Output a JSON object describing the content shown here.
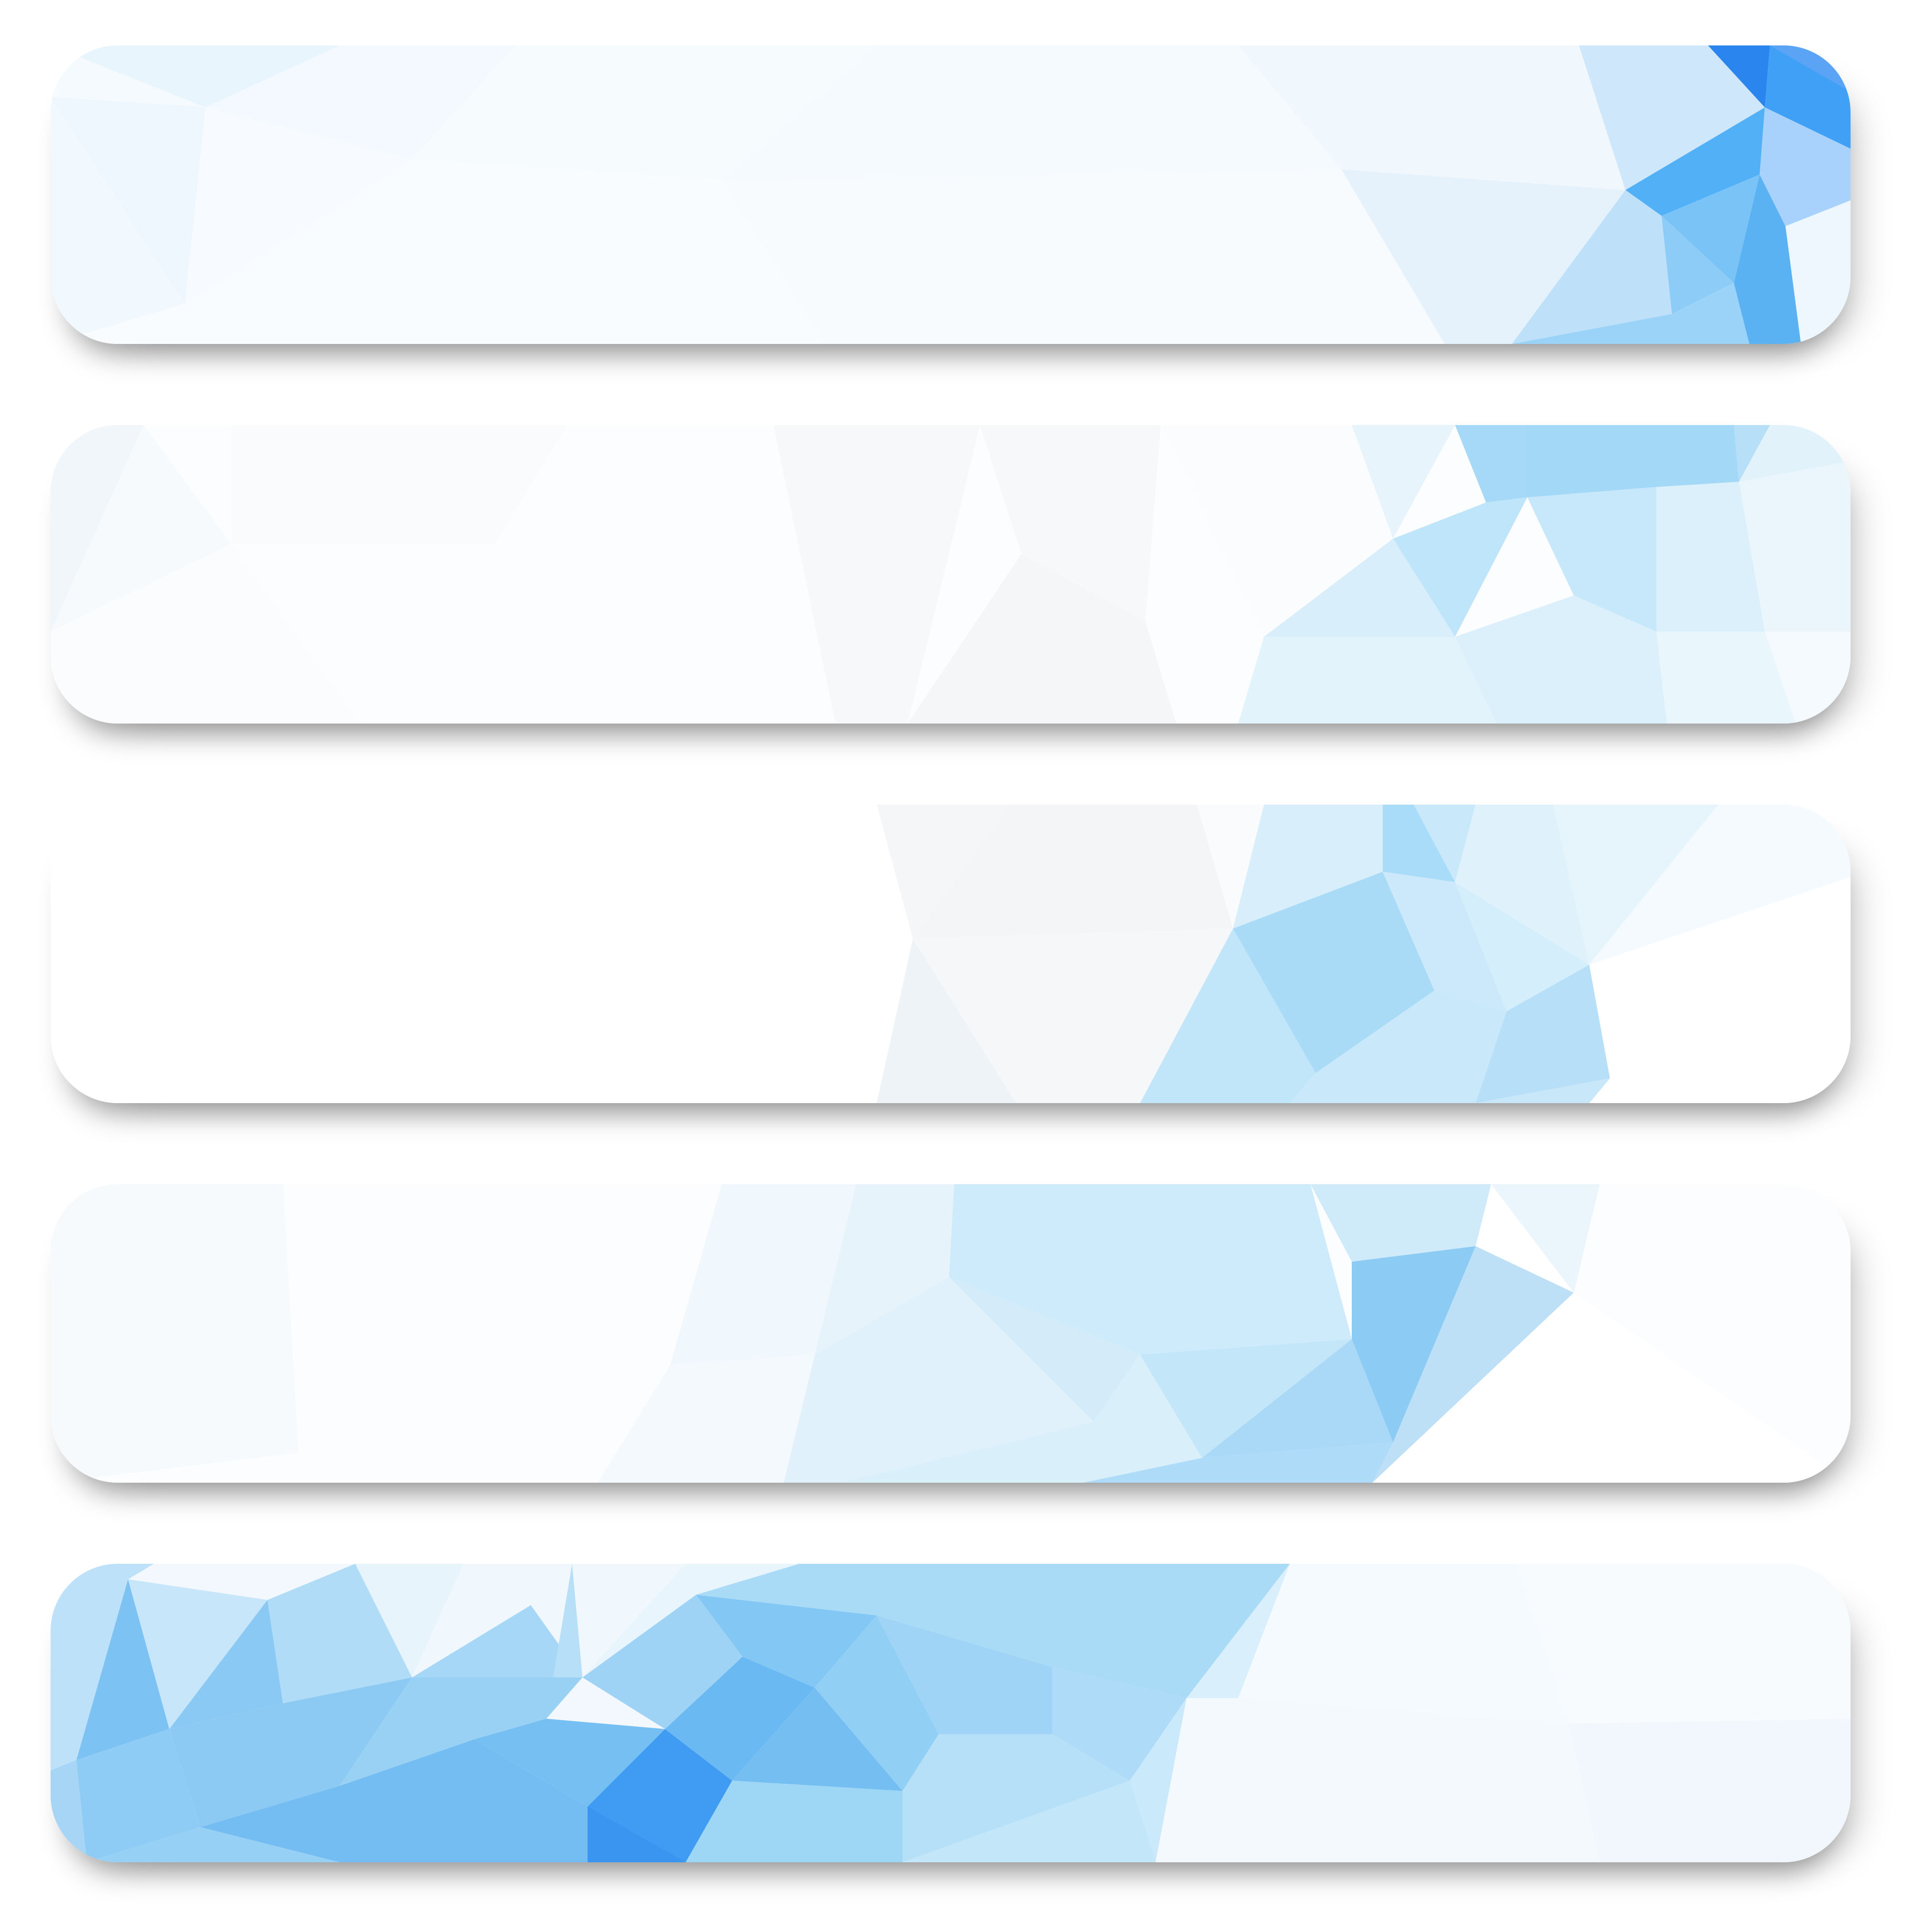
{
  "banners": [
    {
      "id": 1,
      "accent": "#2f8ff0",
      "pale": "#eef7fd",
      "accent_side": "right"
    },
    {
      "id": 2,
      "accent": "#8fd0f5",
      "pale": "#f7fafd",
      "accent_side": "right"
    },
    {
      "id": 3,
      "accent": "#9fd7f6",
      "pale": "#ffffff",
      "accent_side": "right"
    },
    {
      "id": 4,
      "accent": "#7cc1f1",
      "pale": "#fbfdfe",
      "accent_side": "center"
    },
    {
      "id": 5,
      "accent": "#3a9af2",
      "pale": "#f2f8fd",
      "accent_side": "left"
    }
  ],
  "theme": {
    "background": "#ffffff",
    "shadow": "#9a9a9a"
  }
}
